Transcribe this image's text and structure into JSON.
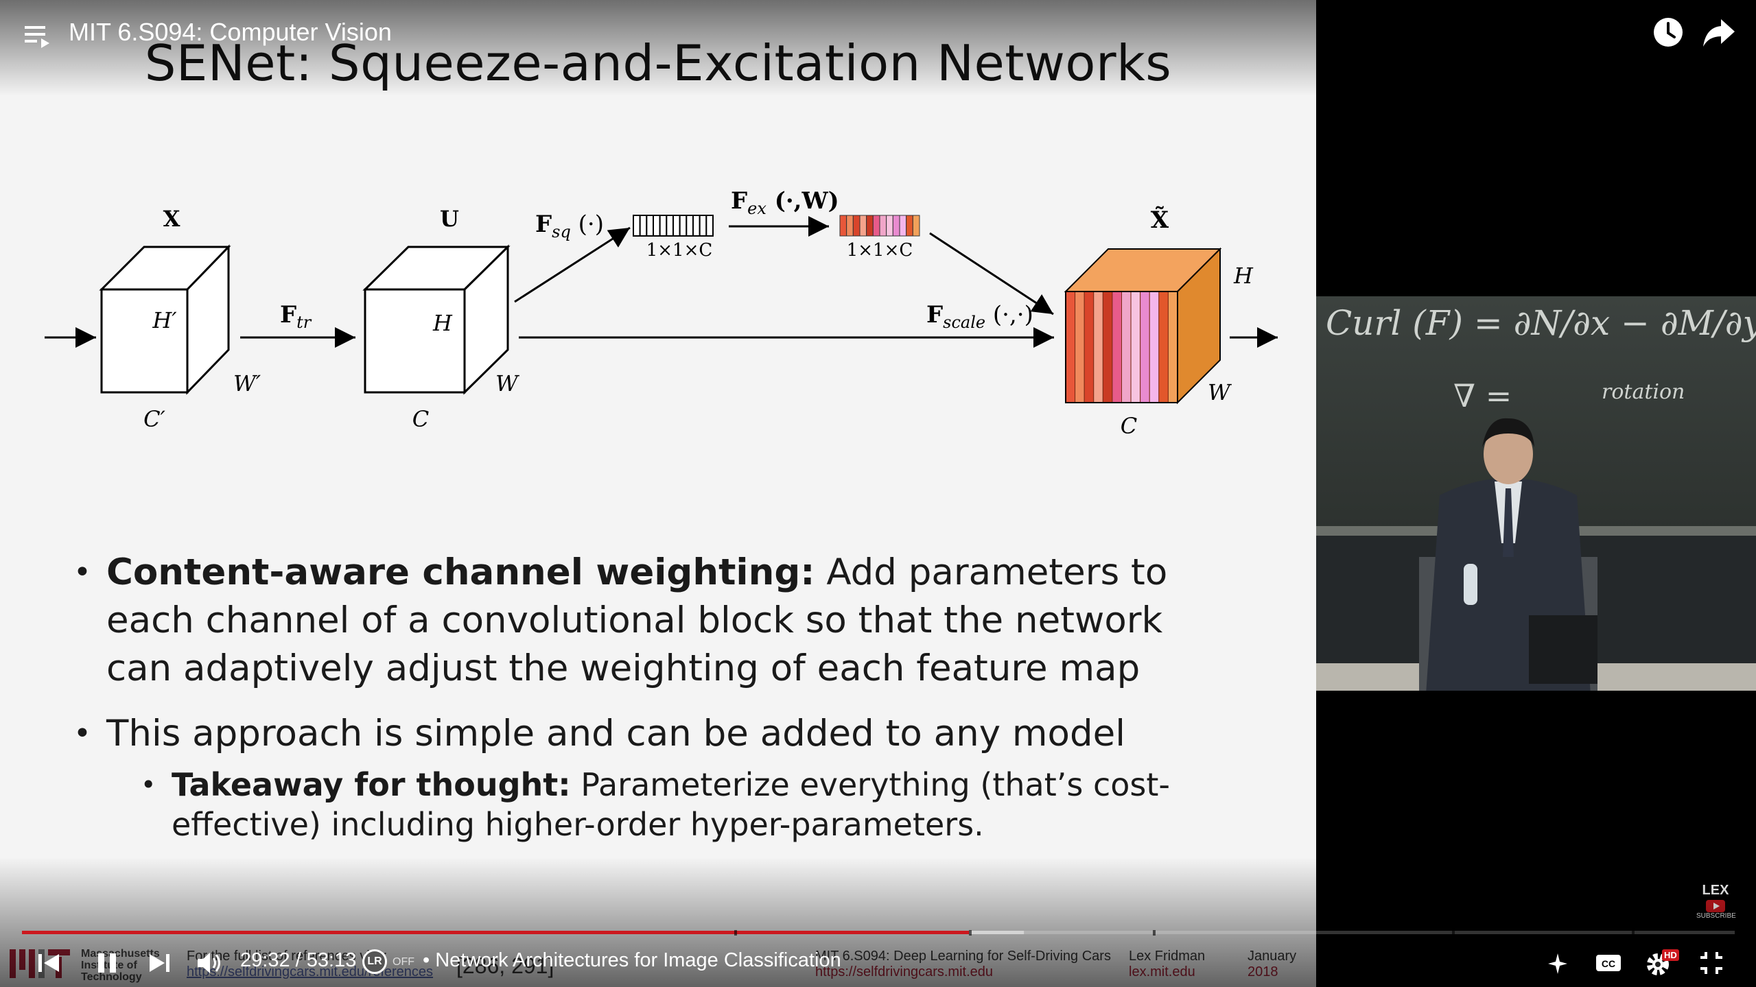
{
  "player": {
    "video_title": "MIT 6.S094: Computer Vision",
    "time_current": "29:32",
    "time_separator": " / ",
    "time_total": "53:13",
    "chapter": "• Network Architectures for Image Classification",
    "autoplay_state": "OFF",
    "progress_played_fraction": 0.553,
    "progress_buffered_fraction": 0.585,
    "accent_color": "#cc181e",
    "hd_badge": "HD"
  },
  "slide": {
    "title": "SENet: Squeeze-and-Excitation Networks",
    "diagram": {
      "input_label": "X",
      "input_h": "H′",
      "input_w": "W′",
      "input_c": "C′",
      "ftr": "F",
      "ftr_sub": "tr",
      "u_label": "U",
      "u_h": "H",
      "u_w": "W",
      "u_c": "C",
      "fsq": "F",
      "fsq_sub": "sq",
      "fsq_args": " (·)",
      "fex": "F",
      "fex_sub": "ex",
      "fex_args": " (·,W)",
      "sq_dim": "1×1×C",
      "ex_dim": "1×1×C",
      "fscale": "F",
      "fscale_sub": "scale",
      "fscale_args": " (·,·)",
      "output_label": "X̃",
      "out_h": "H",
      "out_w": "W",
      "out_c": "C",
      "channel_colors": [
        "#e8573a",
        "#f08a5d",
        "#d9452b",
        "#f4a38c",
        "#c93a23",
        "#e75b8a",
        "#f0a6c9",
        "#f7c4e0",
        "#e98bd0",
        "#f4b6ea",
        "#e2572b",
        "#f2a15a"
      ]
    },
    "bullets": [
      {
        "lead": "Content-aware channel weighting:",
        "text": " Add parameters to each channel of a convolutional block so that the network can adaptively adjust the weighting of each feature map"
      },
      {
        "lead": "",
        "text": "This approach is simple and can be added to any model"
      }
    ],
    "sub_bullet": {
      "lead": "Takeaway for thought:",
      "text": " Parameterize everything (that’s cost-effective) including higher-order hyper-parameters."
    },
    "footer": {
      "mit_line1": "Massachusetts",
      "mit_line2": "Institute of",
      "mit_line3": "Technology",
      "ref_line1": "For the full list of references visit:",
      "ref_line2": "https://selfdrivingcars.mit.edu/references",
      "ref_num": "[286, 291]",
      "course": "MIT 6.S094: Deep Learning for Self-Driving Cars",
      "course_url": "https://selfdrivingcars.mit.edu",
      "author": "Lex Fridman",
      "author_url": "lex.mit.edu",
      "date_month": "January",
      "date_year": "2018"
    }
  },
  "webcam": {
    "chalk_text": "Curl (F) = ∂N/∂x − ∂M/∂y = k̂·(∇×F)",
    "chalk_note": "rotation",
    "watermark_line1": "LEX",
    "watermark_line2": "SUBSCRIBE"
  }
}
